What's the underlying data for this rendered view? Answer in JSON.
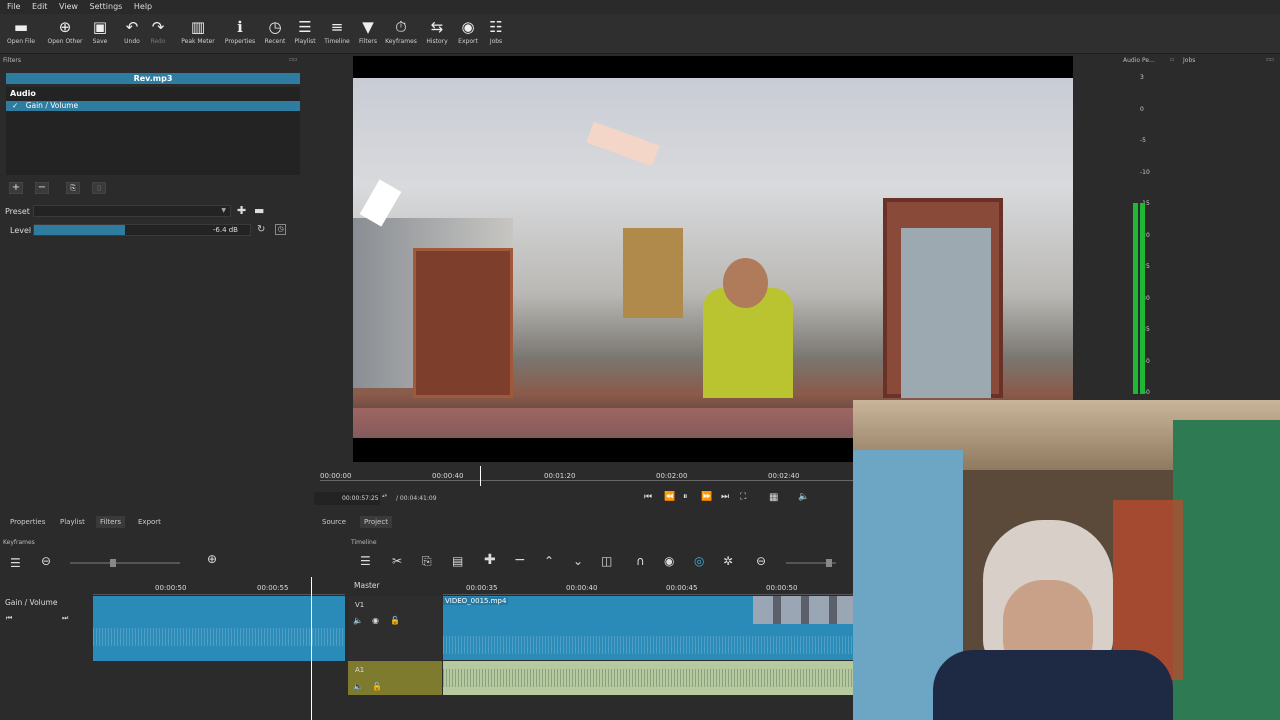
{
  "menu": [
    "File",
    "Edit",
    "View",
    "Settings",
    "Help"
  ],
  "toolbar": [
    {
      "label": "Open File",
      "icon": "folder-icon",
      "enabled": true
    },
    {
      "label": "Open Other",
      "icon": "open-other-icon",
      "enabled": true
    },
    {
      "label": "Save",
      "icon": "save-icon",
      "enabled": true
    },
    {
      "label": "Undo",
      "icon": "undo-icon",
      "enabled": true
    },
    {
      "label": "Redo",
      "icon": "redo-icon",
      "enabled": false
    },
    {
      "label": "Peak Meter",
      "icon": "peak-meter-icon",
      "enabled": true
    },
    {
      "label": "Properties",
      "icon": "info-icon",
      "enabled": true
    },
    {
      "label": "Recent",
      "icon": "clock-icon",
      "enabled": true
    },
    {
      "label": "Playlist",
      "icon": "list-icon",
      "enabled": true
    },
    {
      "label": "Timeline",
      "icon": "timeline-icon",
      "enabled": true
    },
    {
      "label": "Filters",
      "icon": "filter-icon",
      "enabled": true
    },
    {
      "label": "Keyframes",
      "icon": "stopwatch-icon",
      "enabled": true
    },
    {
      "label": "History",
      "icon": "history-icon",
      "enabled": true
    },
    {
      "label": "Export",
      "icon": "export-icon",
      "enabled": true
    },
    {
      "label": "Jobs",
      "icon": "jobs-icon",
      "enabled": true
    }
  ],
  "filters_panel": {
    "title": "Filters",
    "clip_name": "Rev.mp3",
    "category": "Audio",
    "filter_item": "Gain / Volume",
    "check": "✓",
    "preset_label": "Preset",
    "level_label": "Level",
    "level_value": "-6.4 dB",
    "level_fraction": 0.42
  },
  "audio_meter": {
    "title": "Audio Pe...",
    "scale": [
      "3",
      "0",
      "-5",
      "-10",
      "-15",
      "-20",
      "-25",
      "-30",
      "-35",
      "-40",
      "-50"
    ],
    "level_db": -18
  },
  "jobs_panel": {
    "title": "Jobs"
  },
  "player": {
    "ruler_ticks": [
      "00:00:00",
      "00:00:40",
      "00:01:20",
      "00:02:00",
      "00:02:40"
    ],
    "current_time": "00:00:57:25",
    "total_time": "/ 00:04:41:09"
  },
  "left_tabs": [
    "Properties",
    "Playlist",
    "Filters",
    "Export"
  ],
  "right_tabs": [
    "Source",
    "Project"
  ],
  "keyframes": {
    "title": "Keyframes",
    "track_label": "Gain / Volume",
    "ruler_ticks": [
      "00:00:50",
      "00:00:55"
    ]
  },
  "timeline": {
    "title": "Timeline",
    "master_label": "Master",
    "ruler_ticks": [
      "00:00:35",
      "00:00:40",
      "00:00:45",
      "00:00:50"
    ],
    "v1_label": "V1",
    "a1_label": "A1",
    "clip_name": "VIDEO_0015.mp4"
  },
  "colors": {
    "accent": "#2e7da0",
    "clip": "#2a8bb8",
    "audio_track": "#8a8a3a",
    "meter_green": "#22c43a"
  }
}
